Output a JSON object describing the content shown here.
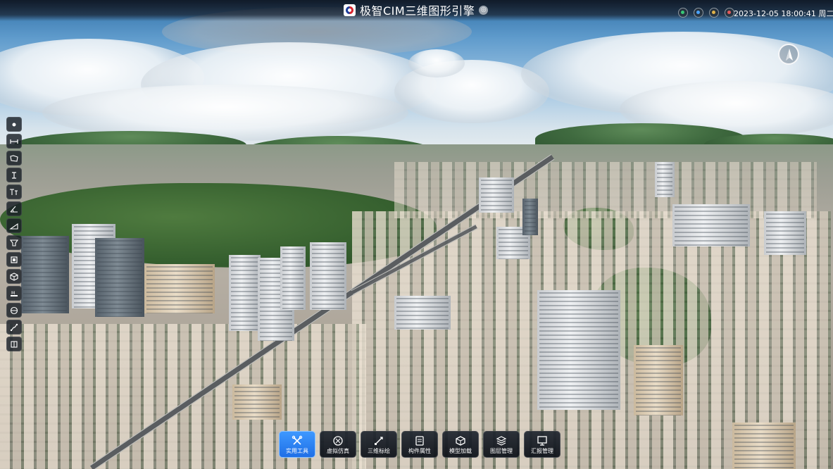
{
  "app": {
    "title": "极智CIM三维图形引擎",
    "title_badge": "◎"
  },
  "status": {
    "datetime": "2023-12-05 18:00:41 周二",
    "icons": [
      "status-green-icon",
      "status-blue-icon",
      "status-amber-icon",
      "status-red-icon"
    ]
  },
  "compass": {
    "label": "N"
  },
  "left_toolbar": {
    "tools": [
      "point-icon",
      "distance-icon",
      "area-icon",
      "height-icon",
      "vertical-height-icon",
      "angle-icon",
      "slope-icon",
      "volume-icon",
      "frame-icon",
      "cube-icon",
      "mark-icon",
      "globe-icon",
      "path-icon",
      "book-icon"
    ]
  },
  "dock": {
    "items": [
      {
        "label": "实用工具",
        "icon": "tools-icon",
        "active": true
      },
      {
        "label": "虚拟仿真",
        "icon": "simulation-icon",
        "active": false
      },
      {
        "label": "三维标绘",
        "icon": "plotting-icon",
        "active": false
      },
      {
        "label": "构件属性",
        "icon": "attributes-icon",
        "active": false
      },
      {
        "label": "模型加载",
        "icon": "model-load-icon",
        "active": false
      },
      {
        "label": "图层管理",
        "icon": "layers-icon",
        "active": false
      },
      {
        "label": "汇报管理",
        "icon": "report-icon",
        "active": false
      }
    ]
  },
  "colors": {
    "accent": "#2f86f5",
    "panel": "#151a22",
    "text": "#ffffff"
  }
}
